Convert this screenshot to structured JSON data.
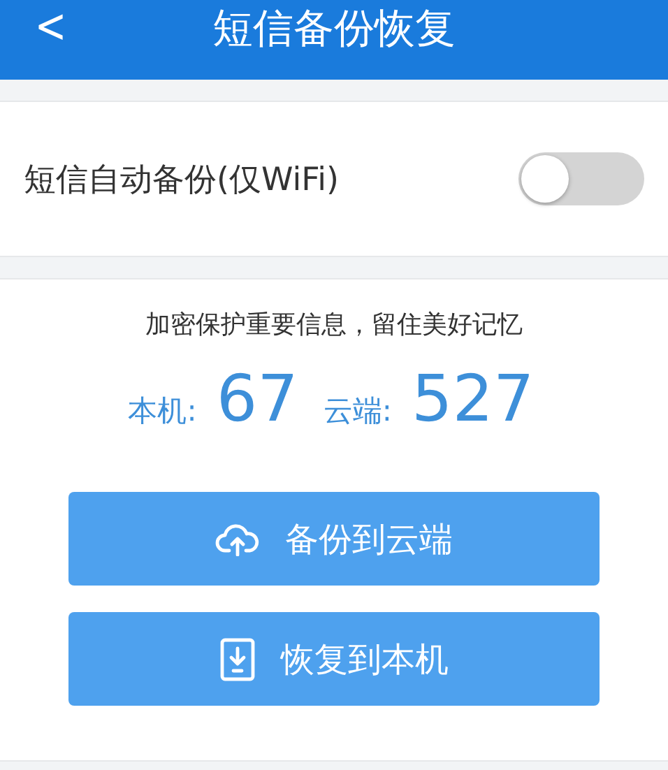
{
  "header": {
    "back_icon": "<",
    "title": "短信备份恢复"
  },
  "auto_backup": {
    "label": "短信自动备份(仅WiFi)",
    "on": false
  },
  "tagline": "加密保护重要信息，留住美好记忆",
  "counts": [
    {
      "label": "本机:",
      "value": "67"
    },
    {
      "label": "云端:",
      "value": "527"
    }
  ],
  "buttons": [
    {
      "kind": "upload",
      "label": "备份到云端"
    },
    {
      "kind": "download",
      "label": "恢复到本机"
    }
  ]
}
